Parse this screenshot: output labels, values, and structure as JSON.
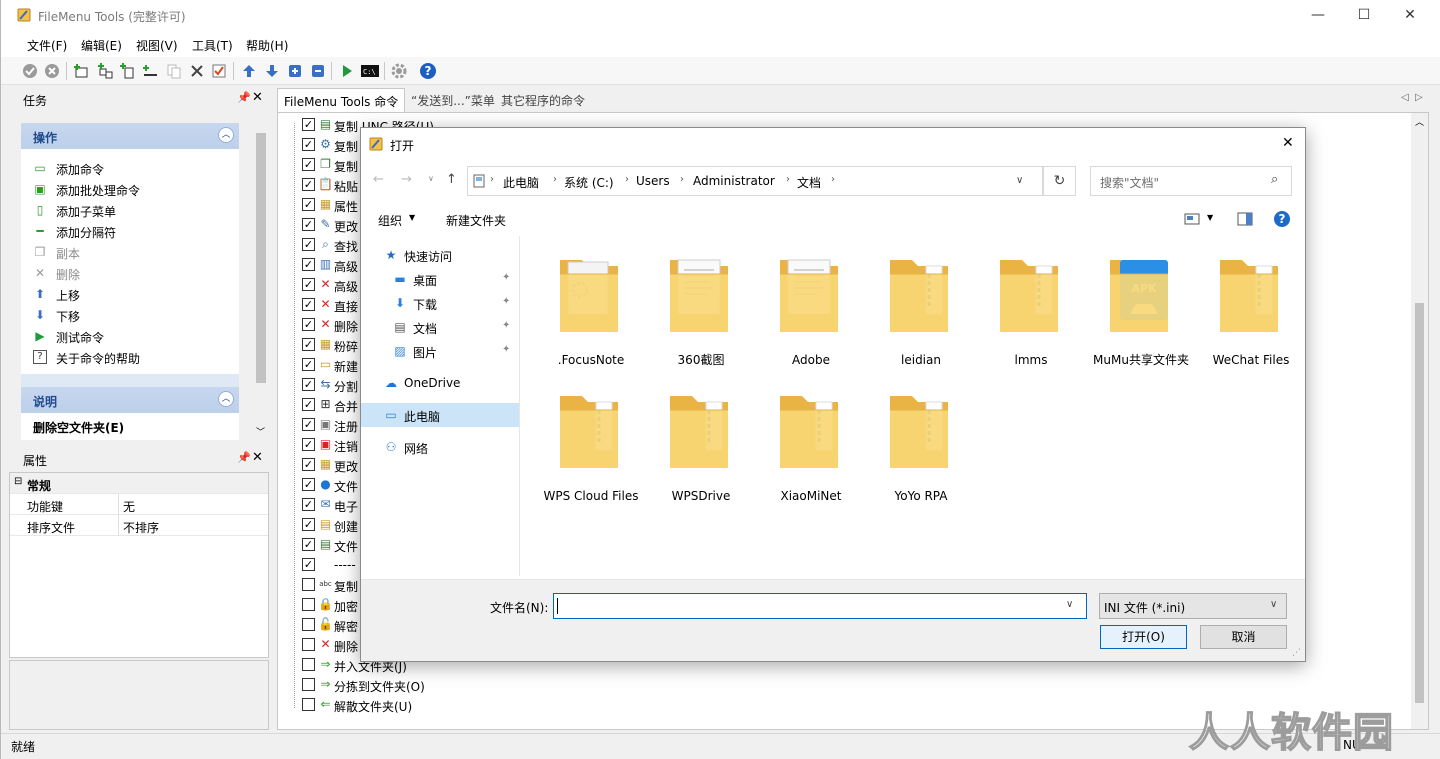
{
  "window": {
    "title": "FileMenu Tools (完整许可)",
    "minimize": "—",
    "maximize": "☐",
    "close": "✕"
  },
  "menu": [
    "文件(F)",
    "编辑(E)",
    "视图(V)",
    "工具(T)",
    "帮助(H)"
  ],
  "tasks_panel": {
    "title": "任务",
    "operations": {
      "title": "操作",
      "items": [
        {
          "label": "添加命令",
          "icon": "add-command-icon",
          "disabled": false
        },
        {
          "label": "添加批处理命令",
          "icon": "add-batch-icon",
          "disabled": false
        },
        {
          "label": "添加子菜单",
          "icon": "add-submenu-icon",
          "disabled": false
        },
        {
          "label": "添加分隔符",
          "icon": "add-separator-icon",
          "disabled": false
        },
        {
          "label": "副本",
          "icon": "copy-icon",
          "disabled": true
        },
        {
          "label": "删除",
          "icon": "delete-icon",
          "disabled": true
        },
        {
          "label": "上移",
          "icon": "move-up-icon",
          "disabled": false
        },
        {
          "label": "下移",
          "icon": "move-down-icon",
          "disabled": false
        },
        {
          "label": "测试命令",
          "icon": "test-icon",
          "disabled": false
        },
        {
          "label": "关于命令的帮助",
          "icon": "help-icon",
          "disabled": false
        }
      ]
    },
    "description": {
      "title": "说明",
      "text": "删除空文件夹(E)"
    }
  },
  "properties_panel": {
    "title": "属性",
    "section": "常规",
    "rows": [
      {
        "key": "功能键",
        "value": "无"
      },
      {
        "key": "排序文件",
        "value": "不排序"
      }
    ]
  },
  "tabs": [
    "FileMenu Tools 命令",
    "“发送到...”菜单",
    "其它程序的命令"
  ],
  "tree_items": [
    {
      "label": "复制 UNC 路径(U)",
      "checked": true
    },
    {
      "label": "复制",
      "checked": true
    },
    {
      "label": "复制",
      "checked": true
    },
    {
      "label": "粘贴",
      "checked": true
    },
    {
      "label": "属性",
      "checked": true
    },
    {
      "label": "更改",
      "checked": true
    },
    {
      "label": "查找",
      "checked": true
    },
    {
      "label": "高级",
      "checked": true
    },
    {
      "label": "高级",
      "checked": true
    },
    {
      "label": "直接",
      "checked": true
    },
    {
      "label": "删除",
      "checked": true
    },
    {
      "label": "粉碎",
      "checked": true
    },
    {
      "label": "新建",
      "checked": true
    },
    {
      "label": "分割",
      "checked": true
    },
    {
      "label": "合并",
      "checked": true
    },
    {
      "label": "注册",
      "checked": true
    },
    {
      "label": "注销",
      "checked": true
    },
    {
      "label": "更改",
      "checked": true
    },
    {
      "label": "文件",
      "checked": true
    },
    {
      "label": "电子",
      "checked": true
    },
    {
      "label": "创建",
      "checked": true
    },
    {
      "label": "文件",
      "checked": true
    },
    {
      "label": "-----",
      "checked": true
    },
    {
      "label": "复制",
      "checked": false
    },
    {
      "label": "加密",
      "checked": false
    },
    {
      "label": "解密",
      "checked": false
    },
    {
      "label": "删除",
      "checked": false
    },
    {
      "label": "并入文件夹(J)",
      "checked": false
    },
    {
      "label": "分拣到文件夹(O)",
      "checked": false
    },
    {
      "label": "解散文件夹(U)",
      "checked": false
    }
  ],
  "status": {
    "left": "就绪",
    "right": "NU"
  },
  "watermark": "人人软件园",
  "dialog": {
    "title": "打开",
    "breadcrumb": [
      "此电脑",
      "系统 (C:)",
      "Users",
      "Administrator",
      "文档"
    ],
    "search_placeholder": "搜索\"文档\"",
    "organize": "组织",
    "new_folder": "新建文件夹",
    "nav": [
      {
        "label": "快速访问",
        "icon": "star-icon",
        "pinned": false,
        "indent": false
      },
      {
        "label": "桌面",
        "icon": "desktop-icon",
        "pinned": true,
        "indent": true
      },
      {
        "label": "下载",
        "icon": "download-icon",
        "pinned": true,
        "indent": true
      },
      {
        "label": "文档",
        "icon": "documents-icon",
        "pinned": true,
        "indent": true
      },
      {
        "label": "图片",
        "icon": "pictures-icon",
        "pinned": true,
        "indent": true
      },
      {
        "label": "OneDrive",
        "icon": "cloud-icon",
        "pinned": false,
        "indent": false
      },
      {
        "label": "此电脑",
        "icon": "computer-icon",
        "pinned": false,
        "indent": false,
        "selected": true
      },
      {
        "label": "网络",
        "icon": "network-icon",
        "pinned": false,
        "indent": false
      }
    ],
    "files": [
      {
        "name": ".FocusNote",
        "kind": "folder-gear"
      },
      {
        "name": "360截图",
        "kind": "folder-doc"
      },
      {
        "name": "Adobe",
        "kind": "folder-doc"
      },
      {
        "name": "leidian",
        "kind": "folder"
      },
      {
        "name": "lmms",
        "kind": "folder"
      },
      {
        "name": "MuMu共享文件夹",
        "kind": "folder-apk"
      },
      {
        "name": "WeChat Files",
        "kind": "folder"
      },
      {
        "name": "WPS Cloud Files",
        "kind": "folder"
      },
      {
        "name": "WPSDrive",
        "kind": "folder"
      },
      {
        "name": "XiaoMiNet",
        "kind": "folder"
      },
      {
        "name": "YoYo RPA",
        "kind": "folder"
      }
    ],
    "filename_label": "文件名(N):",
    "filename_value": "",
    "filetype": "INI 文件 (*.ini)",
    "open_button": "打开(O)",
    "cancel_button": "取消"
  },
  "colors": {
    "accent": "#0067c0",
    "task_header": "#c7d7ee",
    "folder": "#f6cf62",
    "selection": "#cce4f7"
  }
}
